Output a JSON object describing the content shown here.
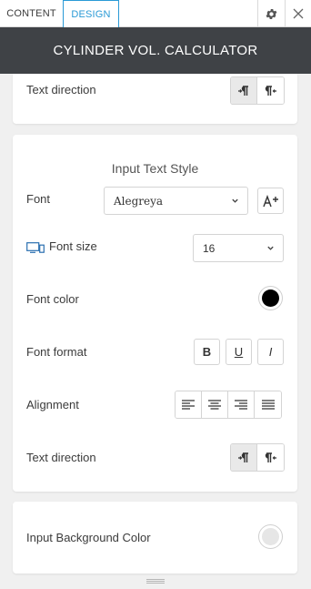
{
  "tabs": {
    "content": "CONTENT",
    "design": "DESIGN"
  },
  "header": {
    "title": "CYLINDER VOL. CALCULATOR"
  },
  "top_section": {
    "text_direction_label": "Text direction"
  },
  "input_text_style": {
    "title": "Input Text Style",
    "font_label": "Font",
    "font_value": "Alegreya",
    "font_size_label": "Font size",
    "font_size_value": "16",
    "font_color_label": "Font color",
    "font_color": "#000000",
    "font_format_label": "Font format",
    "format_buttons": {
      "bold": "B",
      "underline": "U",
      "italic": "I"
    },
    "alignment_label": "Alignment",
    "text_direction_label": "Text direction"
  },
  "background_section": {
    "label": "Input Background Color",
    "color": "#e6e6e6"
  },
  "colors": {
    "accent": "#2a9ad6",
    "header_bg": "#3f4246"
  }
}
